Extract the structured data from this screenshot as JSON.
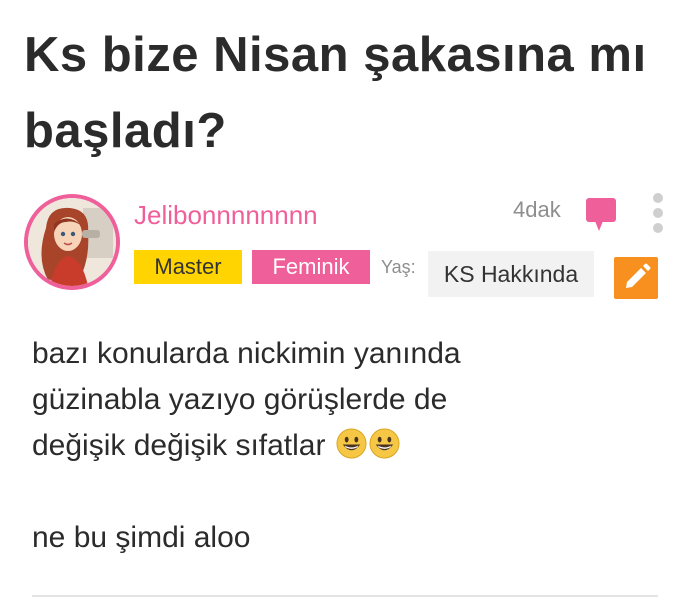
{
  "post": {
    "title": "Ks bize Nisan şakasına mı başladı?",
    "author": {
      "username": "Jelibonnnnnnnn",
      "avatar_icon": "avatar-cartoon-girl"
    },
    "time": "4dak",
    "badges": {
      "master": "Master",
      "feminik": "Feminik"
    },
    "age_label": "Yaş:",
    "about_label": "KS Hakkında",
    "body_lines": [
      "bazı konularda nickimin yanında",
      "güzinabla yazıyo görüşlerde de",
      "değişik değişik sıfatlar"
    ],
    "body_second": "ne bu şimdi aloo",
    "icons": {
      "comment": "comment-icon",
      "more": "more-vertical-icon",
      "edit": "pencil-icon",
      "emoji": "grinning-face-emoji"
    },
    "colors": {
      "accent_pink": "#ef5f9a",
      "master_yellow": "#ffd400",
      "edit_orange": "#f7901e"
    }
  }
}
